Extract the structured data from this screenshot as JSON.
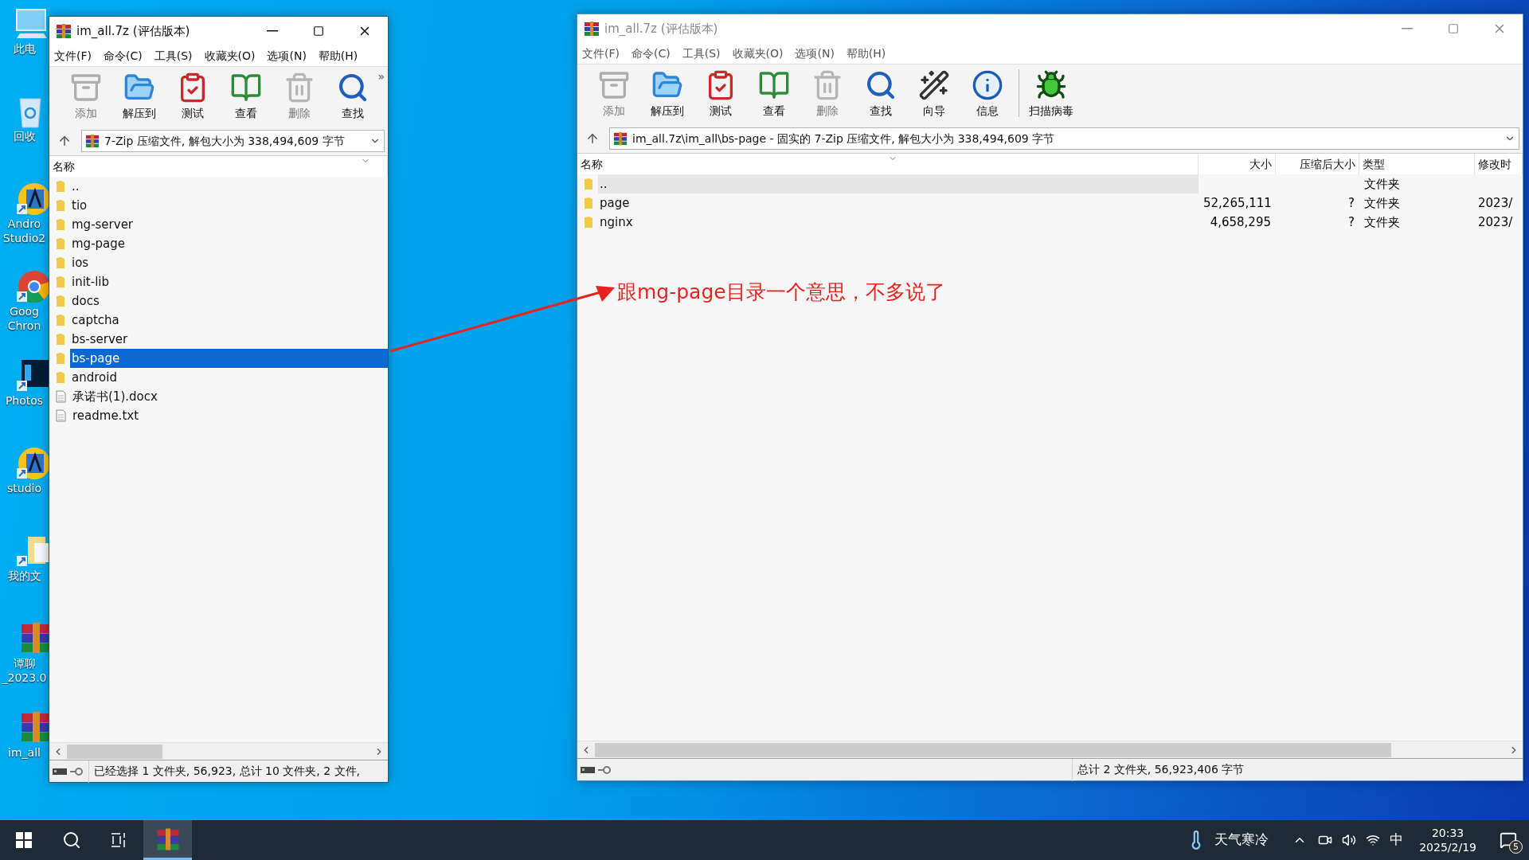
{
  "desktop_icons": [
    {
      "kind": "computer",
      "lines": [
        "此电"
      ]
    },
    {
      "kind": "recycle",
      "lines": [
        "回收"
      ]
    },
    {
      "kind": "studio",
      "lines": [
        "Andro",
        "Studio2"
      ]
    },
    {
      "kind": "chrome",
      "lines": [
        "Goog",
        "Chron"
      ]
    },
    {
      "kind": "photoshop",
      "lines": [
        "Photos"
      ]
    },
    {
      "kind": "studio",
      "lines": [
        "studio"
      ]
    },
    {
      "kind": "documents",
      "lines": [
        "我的文"
      ]
    },
    {
      "kind": "archive",
      "lines": [
        "谭聊",
        "_2023.0"
      ]
    },
    {
      "kind": "archive",
      "lines": [
        "im_all"
      ]
    }
  ],
  "left_window": {
    "title": "im_all.7z (评估版本)",
    "active": true,
    "menu": [
      "文件(F)",
      "命令(C)",
      "工具(S)",
      "收藏夹(O)",
      "选项(N)",
      "帮助(H)"
    ],
    "toolbar": [
      {
        "kind": "add",
        "label": "添加",
        "disabled": true
      },
      {
        "kind": "extract",
        "label": "解压到",
        "disabled": false
      },
      {
        "kind": "test",
        "label": "测试",
        "disabled": false
      },
      {
        "kind": "view",
        "label": "查看",
        "disabled": false
      },
      {
        "kind": "delete",
        "label": "删除",
        "disabled": true
      },
      {
        "kind": "find",
        "label": "查找",
        "disabled": false
      }
    ],
    "overflow": "»",
    "address": "7-Zip 压缩文件, 解包大小为 338,494,609 字节",
    "columns": [
      "名称"
    ],
    "rows": [
      {
        "name": "..",
        "kind": "folder",
        "selected": false
      },
      {
        "name": "tio",
        "kind": "folder",
        "selected": false
      },
      {
        "name": "mg-server",
        "kind": "folder",
        "selected": false
      },
      {
        "name": "mg-page",
        "kind": "folder",
        "selected": false
      },
      {
        "name": "ios",
        "kind": "folder",
        "selected": false
      },
      {
        "name": "init-lib",
        "kind": "folder",
        "selected": false
      },
      {
        "name": "docs",
        "kind": "folder",
        "selected": false
      },
      {
        "name": "captcha",
        "kind": "folder",
        "selected": false
      },
      {
        "name": "bs-server",
        "kind": "folder",
        "selected": false
      },
      {
        "name": "bs-page",
        "kind": "folder",
        "selected": true
      },
      {
        "name": "android",
        "kind": "folder",
        "selected": false
      },
      {
        "name": "承诺书(1).docx",
        "kind": "file",
        "selected": false
      },
      {
        "name": "readme.txt",
        "kind": "file",
        "selected": false
      }
    ],
    "status": "已经选择 1 文件夹, 56,923, 总计 10 文件夹, 2 文件,"
  },
  "right_window": {
    "title": "im_all.7z (评估版本)",
    "active": false,
    "menu": [
      "文件(F)",
      "命令(C)",
      "工具(S)",
      "收藏夹(O)",
      "选项(N)",
      "帮助(H)"
    ],
    "toolbar": [
      {
        "kind": "add",
        "label": "添加",
        "disabled": true
      },
      {
        "kind": "extract",
        "label": "解压到",
        "disabled": false
      },
      {
        "kind": "test",
        "label": "测试",
        "disabled": false
      },
      {
        "kind": "view",
        "label": "查看",
        "disabled": false
      },
      {
        "kind": "delete",
        "label": "删除",
        "disabled": true
      },
      {
        "kind": "find",
        "label": "查找",
        "disabled": false
      },
      {
        "kind": "wizard",
        "label": "向导",
        "disabled": false
      },
      {
        "kind": "info",
        "label": "信息",
        "disabled": false
      },
      {
        "kind": "scan",
        "label": "扫描病毒",
        "disabled": false
      }
    ],
    "address": "im_all.7z\\im_all\\bs-page - 固实的 7-Zip 压缩文件, 解包大小为 338,494,609 字节",
    "columns": [
      "名称",
      "大小",
      "压缩后大小",
      "类型",
      "修改时"
    ],
    "rows": [
      {
        "name": "..",
        "kind": "folder",
        "selected": true,
        "type": "文件夹"
      },
      {
        "name": "page",
        "kind": "folder",
        "selected": false,
        "size": "52,265,111",
        "packed": "?",
        "type": "文件夹",
        "modified": "2023/"
      },
      {
        "name": "nginx",
        "kind": "folder",
        "selected": false,
        "size": "4,658,295",
        "packed": "?",
        "type": "文件夹",
        "modified": "2023/"
      }
    ],
    "status": "总计 2 文件夹, 56,923,406 字节"
  },
  "annotation": {
    "text": "跟mg-page目录一个意思，不多说了"
  },
  "taskbar": {
    "weather": "天气寒冷",
    "ime": "中",
    "time": "20:33",
    "date": "2025/2/19",
    "notifications": "5"
  }
}
